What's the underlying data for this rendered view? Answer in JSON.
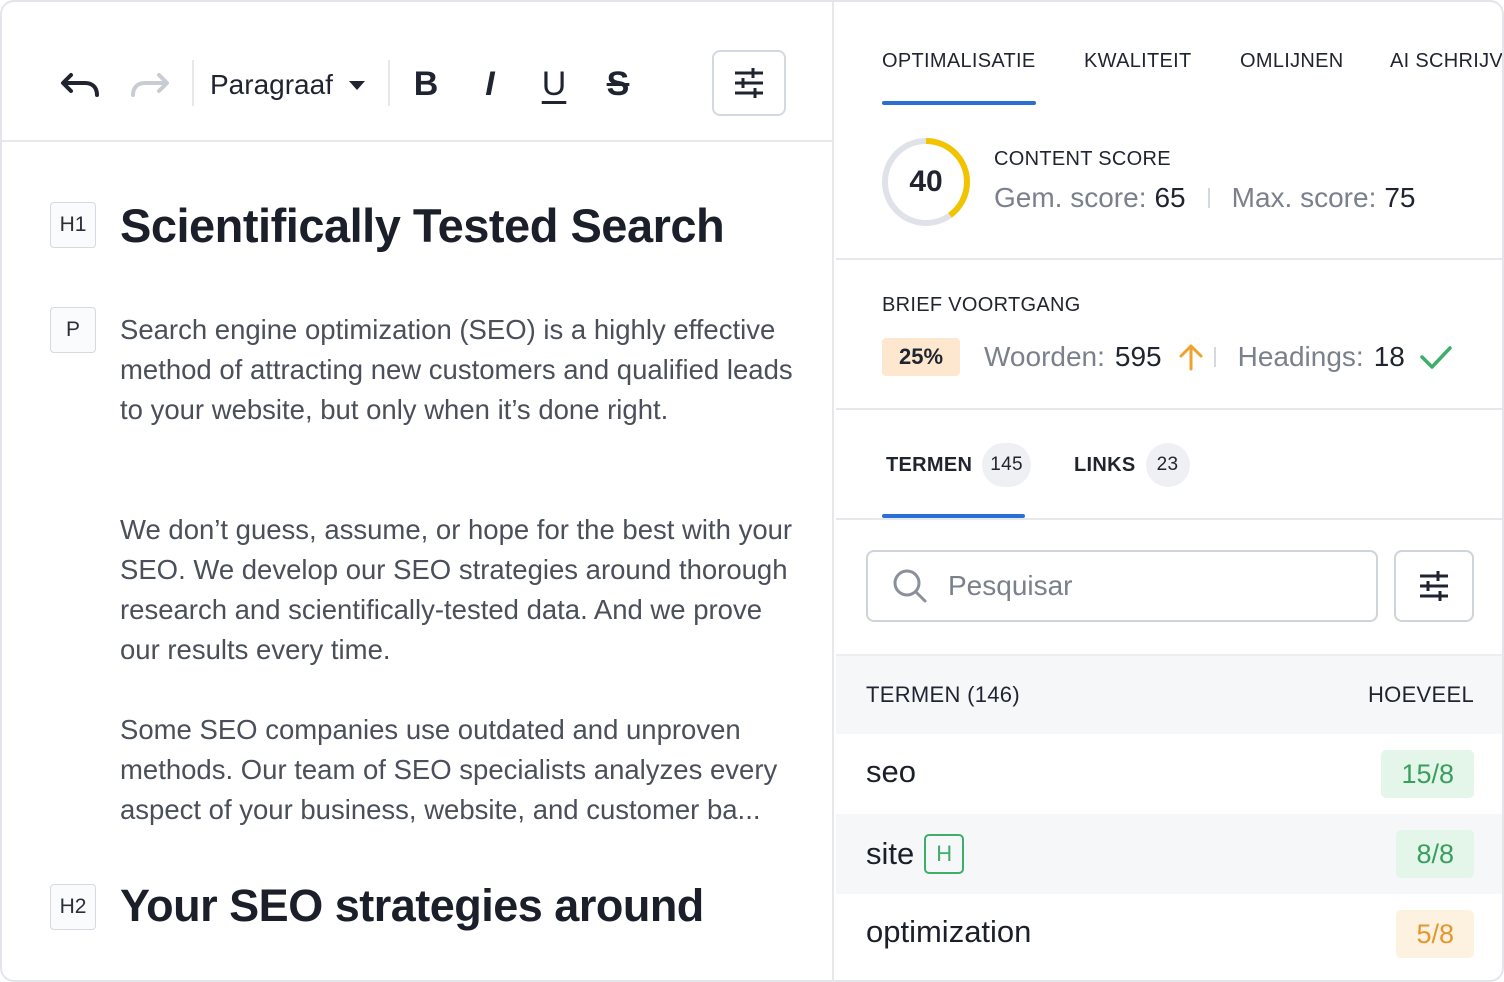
{
  "toolbar": {
    "paragraph_select": "Paragraaf",
    "bold": "B",
    "italic": "I",
    "underline": "U",
    "strike": "S"
  },
  "editor": {
    "h1_tag": "H1",
    "h1_text": "Scientifically Tested Search",
    "p_tag": "P",
    "paragraphs": [
      "Search engine optimization (SEO) is a highly effective method of attracting new customers and qualified leads to your website, but only when it’s done right.",
      "We don’t guess, assume, or hope for the best with your SEO. We develop our SEO strategies around thorough research and scientifically-tested data. And we prove our results every time.",
      "Some SEO companies use outdated and unproven methods. Our team of SEO specialists analyzes every aspect of your business, website, and customer ba..."
    ],
    "h2_tag": "H2",
    "h2_text": "Your SEO strategies around"
  },
  "panel": {
    "tabs": [
      "OPTIMALISATIE",
      "KWALITEIT",
      "OMLIJNEN",
      "AI SCHRIJVE"
    ],
    "content_score": {
      "label": "CONTENT SCORE",
      "value": "40",
      "value_fraction": 0.4,
      "avg_label": "Gem. score:",
      "avg_value": "65",
      "max_label": "Max. score:",
      "max_value": "75",
      "ring_color": "#f2c400"
    },
    "brief": {
      "label": "BRIEF VOORTGANG",
      "percent": "25%",
      "words_label": "Woorden:",
      "words_value": "595",
      "headings_label": "Headings:",
      "headings_value": "18"
    },
    "subtabs": [
      {
        "label": "TERMEN",
        "count": "145"
      },
      {
        "label": "LINKS",
        "count": "23"
      }
    ],
    "search": {
      "placeholder": "Pesquisar"
    },
    "table": {
      "col_terms": "TERMEN (146)",
      "col_amount": "HOEVEEL",
      "rows": [
        {
          "term": "seo",
          "amount": "15/8",
          "status": "good"
        },
        {
          "term": "site",
          "badge": "H",
          "amount": "8/8",
          "status": "good"
        },
        {
          "term": "optimization",
          "amount": "5/8",
          "status": "warn"
        }
      ]
    }
  },
  "colors": {
    "accent_blue": "#2b6fd6",
    "good_green": "#3a9e5f",
    "warn_orange": "#e6962f"
  }
}
